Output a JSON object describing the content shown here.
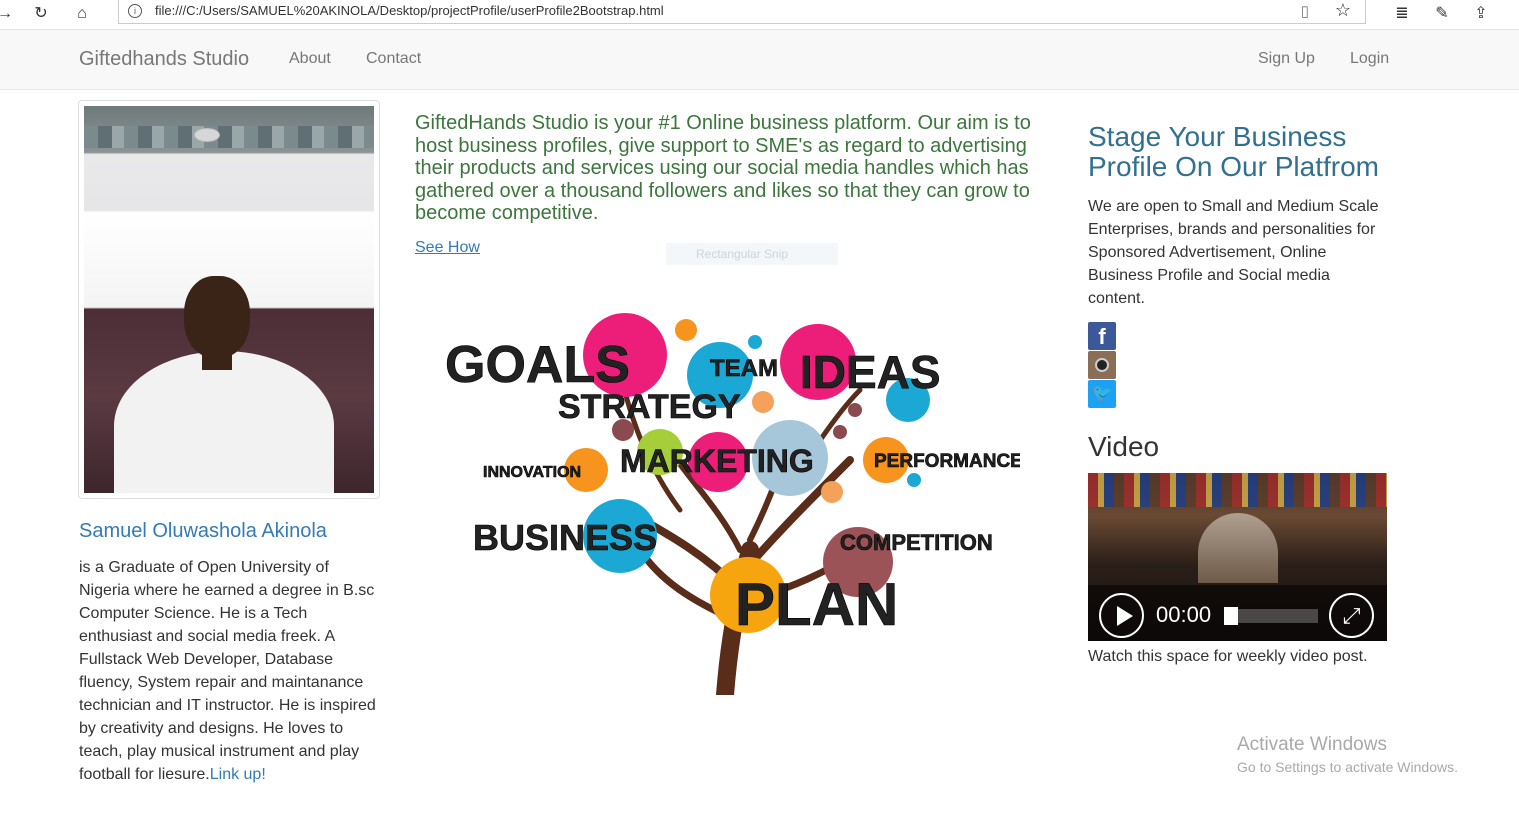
{
  "browser": {
    "url": "file:///C:/Users/SAMUEL%20AKINOLA/Desktop/projectProfile/userProfile2Bootstrap.html"
  },
  "navbar": {
    "brand": "Giftedhands Studio",
    "links": [
      "About",
      "Contact"
    ],
    "right_links": [
      "Sign Up",
      "Login"
    ]
  },
  "profile": {
    "name": "Samuel Oluwashola Akinola",
    "bio": "is a Graduate of Open University of Nigeria where he earned a degree in B.sc Computer Science. He is a Tech enthusiast and social media freek. A Fullstack Web Developer, Database fluency, System repair and maintanance technician and IT instructor. He is inspired by creativity and designs. He loves to teach, play musical instrument and play football for liesure.",
    "link_text": "Link up!"
  },
  "main": {
    "intro": "GiftedHands Studio is your #1 Online business platform. Our aim is to host business profiles, give support to SME's as regard to advertising their products and services using our social media handles which has gathered over a thousand followers and likes so that they can grow to become competitive.",
    "see_how": "See How",
    "snip_overlay": "Rectangular Snip",
    "tree_words": {
      "goals": "GOALS",
      "team": "TEAM",
      "ideas": "IDEAS",
      "strategy": "STRATEGY",
      "innovation": "INNOVATION",
      "marketing": "MARKETING",
      "performance": "PERFORMANCE",
      "business": "BUSINESS",
      "competition": "COMPETITION",
      "plan": "PLAN"
    }
  },
  "sidebar": {
    "heading": "Stage Your Business Profile On Our Platfrom",
    "text": "We are open to Small and Medium Scale Enterprises, brands and personalities for Sponsored Advertisement, Online Business Profile and Social media content.",
    "social": [
      "facebook",
      "instagram",
      "twitter"
    ],
    "video_heading": "Video",
    "video_time": "00:00",
    "video_caption": "Watch this space for weekly video post."
  },
  "watermark": {
    "title": "Activate Windows",
    "subtitle": "Go to Settings to activate Windows."
  },
  "colors": {
    "link": "#337ab7",
    "intro_green": "#3c763d",
    "heading_blue": "#31708f",
    "navbar_bg": "#f8f8f8"
  }
}
